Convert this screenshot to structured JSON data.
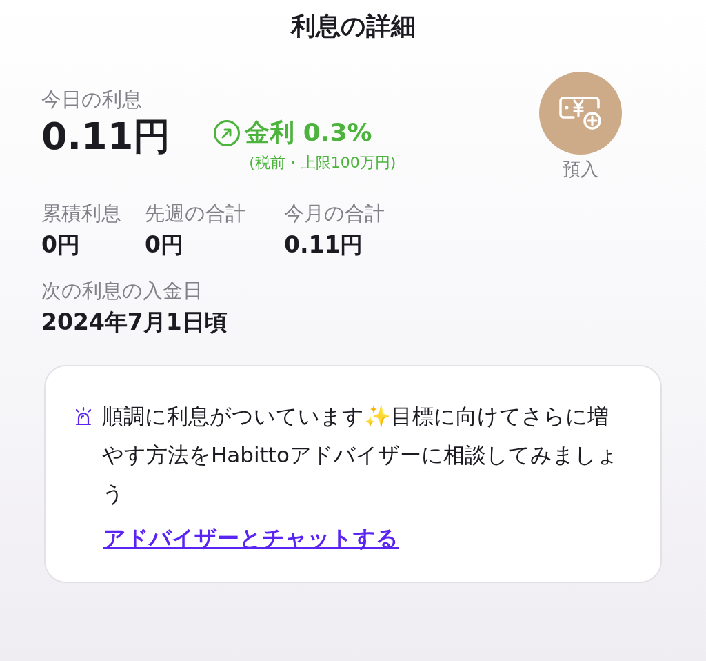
{
  "title": "利息の詳細",
  "today": {
    "label": "今日の利息",
    "amount": "0.11円"
  },
  "rate": {
    "text": "金利 0.3%",
    "note": "(税前・上限100万円)"
  },
  "deposit": {
    "label": "預入"
  },
  "totals": [
    {
      "label": "累積利息",
      "value": "0円"
    },
    {
      "label": "先週の合計",
      "value": "0円"
    },
    {
      "label": "今月の合計",
      "value": "0.11円"
    }
  ],
  "next_payment": {
    "label": "次の利息の入金日",
    "value": "2024年7月1日頃"
  },
  "notice": {
    "message": "順調に利息がついています✨目標に向けてさらに増やす方法をHabittoアドバイザーに相談してみましょう",
    "link": "アドバイザーとチャットする"
  }
}
